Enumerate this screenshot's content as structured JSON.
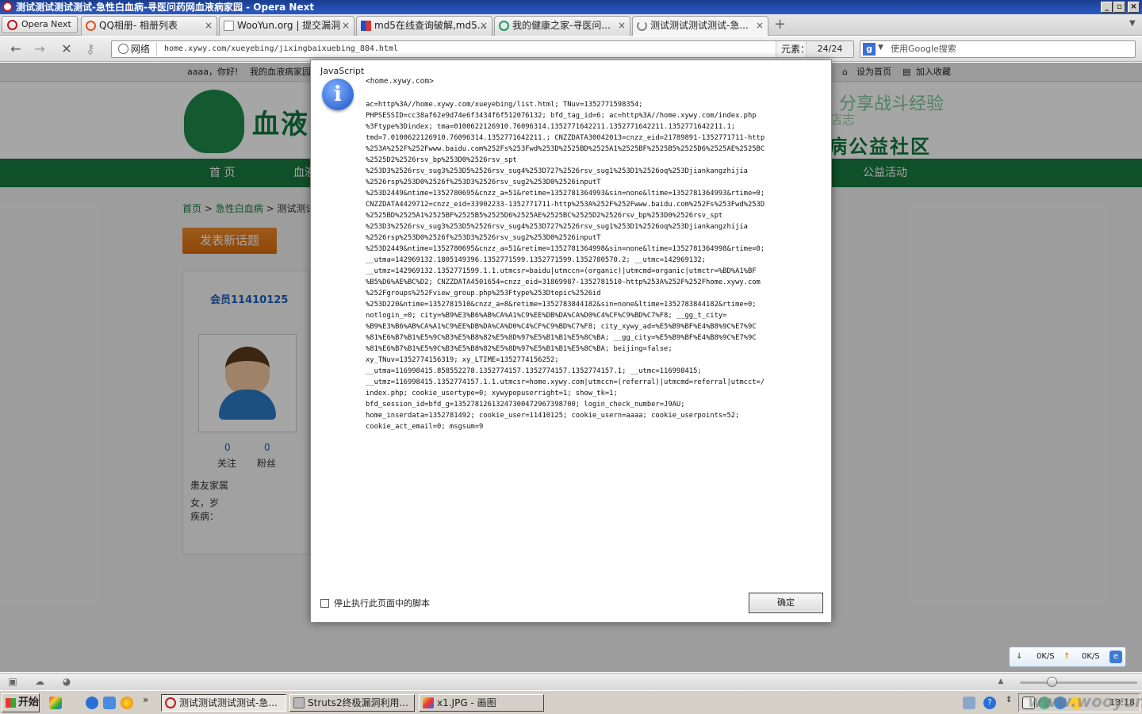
{
  "window": {
    "title": "测试测试测试测试-急性白血病-寻医问药网血液病家园 - Opera Next"
  },
  "tabs": {
    "menu_label": "Opera Next",
    "items": [
      {
        "label": "QQ相册- 相册列表",
        "close": "×"
      },
      {
        "label": "WooYun.org | 提交漏洞",
        "close": "×"
      },
      {
        "label": "md5在线查询破解,md5...",
        "close": "×"
      },
      {
        "label": "我的健康之家-寻医问...",
        "close": "×"
      },
      {
        "label": "测试测试测试测试-急...",
        "close": "×"
      }
    ],
    "new_tab": "+"
  },
  "address_bar": {
    "site_badge": "网络",
    "url": "home.xywy.com/xueyebing/jixingbaixuebing_884.html",
    "element_label": "元素：",
    "element_count": "24/24",
    "search_engine_letter": "g",
    "search_placeholder": "使用Google搜索"
  },
  "page": {
    "topbar": {
      "greeting": "aaaa，你好!",
      "my_home": "我的血液病家园",
      "set_home": "设为首页",
      "favorite": "加入收藏"
    },
    "logo_text": "血液",
    "slogan_top": "分享战斗经验",
    "slogan_mid": "店志",
    "slogan_bottom": "病公益社区",
    "nav": {
      "home": "首 页",
      "blood": "血液",
      "charity": "公益活动"
    },
    "breadcrumb": {
      "home": "首页",
      "sep": ">",
      "category": "急性白血病",
      "current": "测试测试"
    },
    "post_button": "发表新话题",
    "member": {
      "name": "会员11410125",
      "follow_count": "0",
      "follow_label": "关注",
      "fans_count": "0",
      "fans_label": "粉丝",
      "role": "患友家属",
      "gender_age": "女，岁",
      "disease": "疾病："
    }
  },
  "dialog": {
    "title": "JavaScript",
    "host": "<home.xywy.com>",
    "message_lines": [
      "ac=http%3A//home.xywy.com/xueyebing/list.html; TNuv=1352771598354;",
      "PHPSESSID=cc38af62e9d74e6f3434f6f512076132; bfd_tag_id=6; ac=http%3A//home.xywy.com/index.php",
      "%3Ftype%3Dindex; tma=0100622126910.76096314.1352771642211.1352771642211.1352771642211.1;",
      "tmd=7.0100622126910.76096314.1352771642211.; CNZZDATA30042013=cnzz_eid=21789891-1352771711-http",
      "%253A%252F%252Fwww.baidu.com%252Fs%253Fwd%253D%2525BD%2525A1%2525BF%2525B5%2525D6%2525AE%2525BC",
      "%2525D2%2526rsv_bp%253D0%2526rsv_spt",
      "%253D3%2526rsv_sug3%253D5%2526rsv_sug4%253D727%2526rsv_sug1%253D1%2526oq%253Djiankangzhijia",
      "%2526rsp%253D0%2526f%253D3%2526rsv_sug2%253D0%2526inputT",
      "%253D2449&ntime=1352780695&cnzz_a=51&retime=1352781364993&sin=none&ltime=1352781364993&rtime=0;",
      "CNZZDATA4429712=cnzz_eid=33902233-1352771711-http%253A%252F%252Fwww.baidu.com%252Fs%253Fwd%253D",
      "%2525BD%2525A1%2525BF%2525B5%2525D6%2525AE%2525BC%2525D2%2526rsv_bp%253D0%2526rsv_spt",
      "%253D3%2526rsv_sug3%253D5%2526rsv_sug4%253D727%2526rsv_sug1%253D1%2526oq%253Djiankangzhijia",
      "%2526rsp%253D0%2526f%253D3%2526rsv_sug2%253D0%2526inputT",
      "%253D2449&ntime=1352780695&cnzz_a=51&retime=1352781364998&sin=none&ltime=1352781364998&rtime=0;",
      "__utma=142969132.1805149396.1352771599.1352771599.1352780570.2; __utmc=142969132;",
      "__utmz=142969132.1352771599.1.1.utmcsr=baidu|utmccn=(organic)|utmcmd=organic|utmctr=%BD%A1%BF",
      "%B5%D6%AE%BC%D2; CNZZDATA4501654=cnzz_eid=31869987-1352781510-http%253A%252F%252Fhome.xywy.com",
      "%252Fgroups%252Fview_group.php%253Ftype%253Dtopic%2526id",
      "%253D220&ntime=1352781510&cnzz_a=8&retime=1352783844182&sin=none&ltime=1352783844182&rtime=0;",
      "notlogin_=0; city=%B9%E3%B6%AB%CA%A1%C9%EE%DB%DA%CA%D0%C4%CF%C9%BD%C7%F8; __gg_t_city=",
      "%B9%E3%B6%AB%CA%A1%C9%EE%DB%DA%CA%D0%C4%CF%C9%BD%C7%F8; city_xywy_ad=%E5%B9%BF%E4%B8%9C%E7%9C",
      "%81%E6%B7%B1%E5%9C%B3%E5%B8%82%E5%8D%97%E5%B1%B1%E5%8C%BA; __gg_city=%E5%B9%BF%E4%B8%9C%E7%9C",
      "%81%E6%B7%B1%E5%9C%B3%E5%B8%82%E5%8D%97%E5%B1%B1%E5%8C%BA; beijing=false;",
      "xy_TNuv=1352774156319; xy_LTIME=1352774156252;",
      "__utma=116998415.858552278.1352774157.1352774157.1352774157.1; __utmc=116998415;",
      "__utmz=116998415.1352774157.1.1.utmcsr=home.xywy.com|utmccn=(referral)|utmcmd=referral|utmcct=/",
      "index.php; cookie_usertype=0; xywypopuserright=1; show_tk=1;",
      "bfd_session_id=bfd_g=1352781261324730047296739870​0; login_check_number=J9AU;",
      "home_inserdata=1352781492; cookie_user=11410125; cookie_usern=aaaa; cookie_userpoints=52;",
      "cookie_act_email=0; msgsum=9"
    ],
    "stop_scripts_label": "停止执行此页面中的脚本",
    "ok_label": "确定"
  },
  "transfer": {
    "down_rate": "0K/S",
    "up_rate": "0K/S"
  },
  "taskbar": {
    "start_label": "开始",
    "overflow": "»",
    "tasks": [
      {
        "label": "测试测试测试测试-急..."
      },
      {
        "label": "Struts2终极漏洞利用..."
      },
      {
        "label": "x1.JPG - 画图"
      }
    ],
    "clock": "13:18"
  },
  "watermark": "www.wooyun.org",
  "colors": {
    "site_green": "#177a3f",
    "accent_orange": "#e07b1a",
    "link_blue": "#1d5fb5",
    "titlebar_blue": "#1a3d8f"
  }
}
